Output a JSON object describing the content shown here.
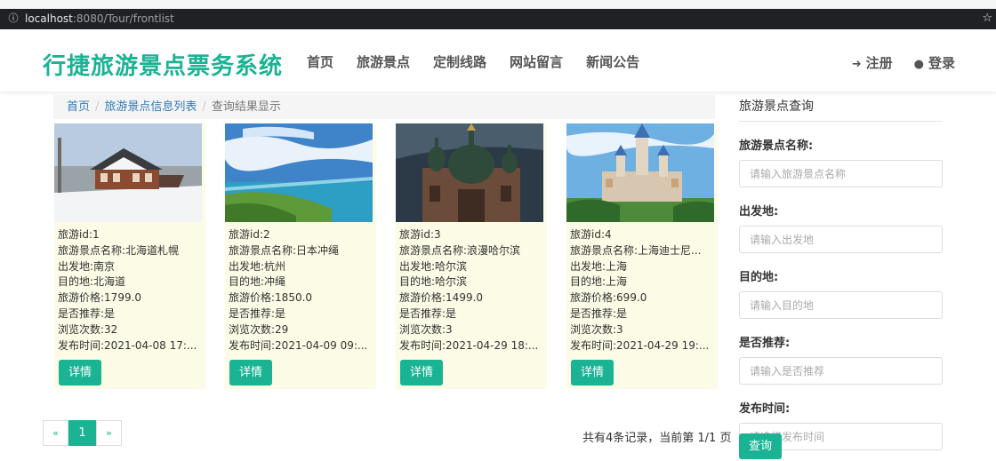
{
  "browser": {
    "url_host": "localhost",
    "url_rest": ":8080/Tour/frontlist"
  },
  "header": {
    "brand": "行捷旅游景点票务系统",
    "nav": [
      "首页",
      "旅游景点",
      "定制线路",
      "网站留言",
      "新闻公告"
    ],
    "register": "注册",
    "login": "登录"
  },
  "breadcrumb": {
    "home": "首页",
    "list": "旅游景点信息列表",
    "current": "查询结果显示"
  },
  "cards": [
    {
      "id": "旅游id:1",
      "name": "旅游景点名称:北海道札幌",
      "from": "出发地:南京",
      "to": "目的地:北海道",
      "price": "旅游价格:1799.0",
      "recommend": "是否推荐:是",
      "views": "浏览次数:32",
      "time": "发布时间:2021-04-08 17:...",
      "btn": "详情"
    },
    {
      "id": "旅游id:2",
      "name": "旅游景点名称:日本冲绳",
      "from": "出发地:杭州",
      "to": "目的地:冲绳",
      "price": "旅游价格:1850.0",
      "recommend": "是否推荐:是",
      "views": "浏览次数:29",
      "time": "发布时间:2021-04-09 09:...",
      "btn": "详情"
    },
    {
      "id": "旅游id:3",
      "name": "旅游景点名称:浪漫哈尔滨",
      "from": "出发地:哈尔滨",
      "to": "目的地:哈尔滨",
      "price": "旅游价格:1499.0",
      "recommend": "是否推荐:是",
      "views": "浏览次数:3",
      "time": "发布时间:2021-04-29 18:...",
      "btn": "详情"
    },
    {
      "id": "旅游id:4",
      "name": "旅游景点名称:上海迪士尼...",
      "from": "出发地:上海",
      "to": "目的地:上海",
      "price": "旅游价格:699.0",
      "recommend": "是否推荐:是",
      "views": "浏览次数:3",
      "time": "发布时间:2021-04-29 19:...",
      "btn": "详情"
    }
  ],
  "pagination": {
    "prev": "«",
    "current": "1",
    "next": "»",
    "summary": "共有4条记录，当前第 1/1 页"
  },
  "sidebar": {
    "title": "旅游景点查询",
    "fields": [
      {
        "label": "旅游景点名称:",
        "placeholder": "请输入旅游景点名称"
      },
      {
        "label": "出发地:",
        "placeholder": "请输入出发地"
      },
      {
        "label": "目的地:",
        "placeholder": "请输入目的地"
      },
      {
        "label": "是否推荐:",
        "placeholder": "请输入是否推荐"
      },
      {
        "label": "发布时间:",
        "placeholder": "请选择发布时间"
      }
    ],
    "search_label": "查询"
  },
  "colors": {
    "accent": "#1ab394",
    "link": "#337ab7",
    "card_bg": "#fbfbe6"
  },
  "icons": {
    "info": "info-circle-icon",
    "star": "bookmark-star-icon",
    "register": "sign-in-icon",
    "login": "user-icon"
  }
}
